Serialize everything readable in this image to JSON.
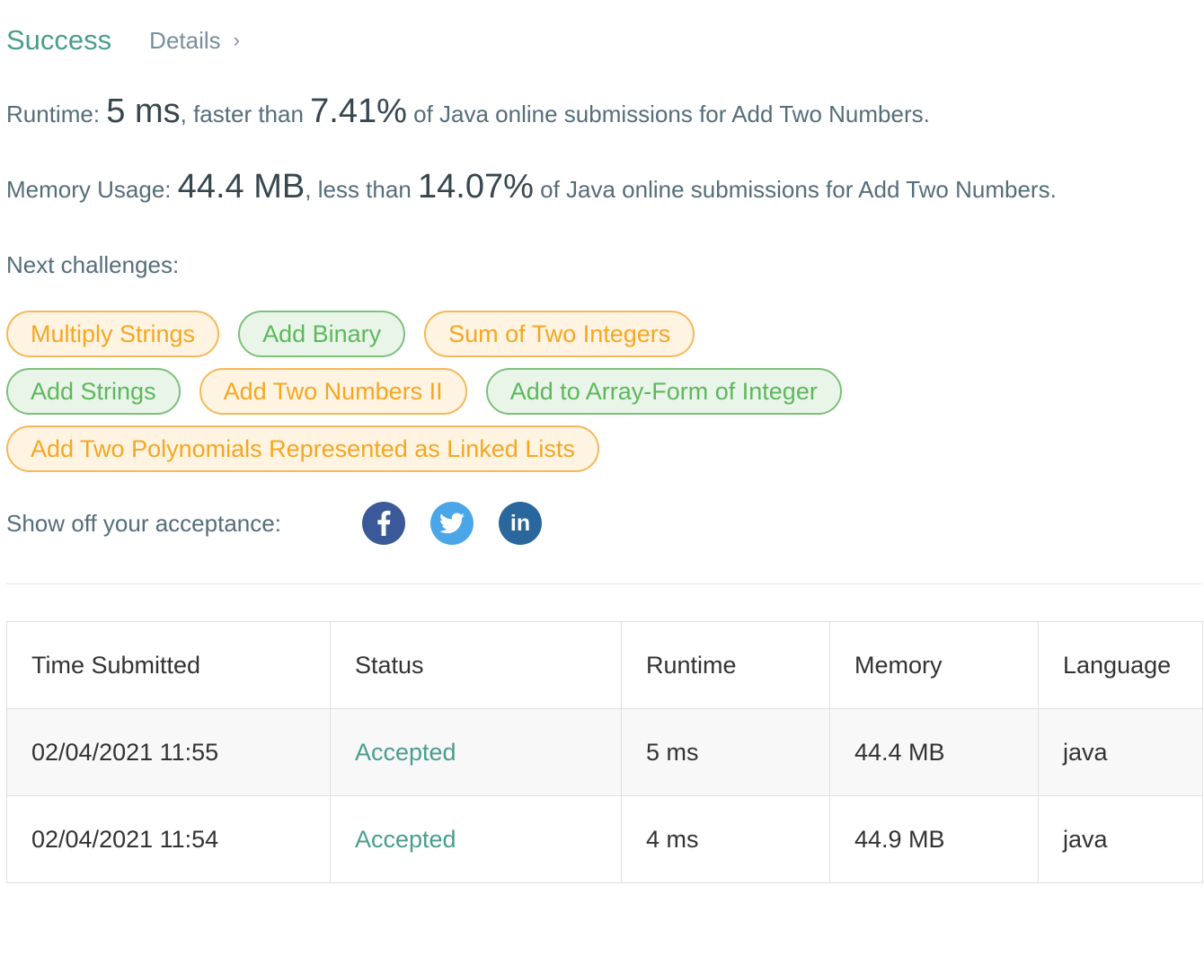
{
  "header": {
    "status": "Success",
    "details_label": "Details",
    "details_chevron": "›"
  },
  "runtime": {
    "label": "Runtime: ",
    "value": "5 ms",
    "comparison": ", faster than ",
    "percent": "7.41%",
    "suffix": " of Java online submissions for Add Two Numbers."
  },
  "memory": {
    "label": "Memory Usage: ",
    "value": "44.4 MB",
    "comparison": ", less than ",
    "percent": "14.07%",
    "suffix": " of Java online submissions for Add Two Numbers."
  },
  "next_challenges": {
    "label": "Next challenges:",
    "items": [
      {
        "label": "Multiply Strings",
        "color": "orange"
      },
      {
        "label": "Add Binary",
        "color": "green"
      },
      {
        "label": "Sum of Two Integers",
        "color": "orange"
      },
      {
        "label": "Add Strings",
        "color": "green"
      },
      {
        "label": "Add Two Numbers II",
        "color": "orange"
      },
      {
        "label": "Add to Array-Form of Integer",
        "color": "green"
      },
      {
        "label": "Add Two Polynomials Represented as Linked Lists",
        "color": "orange"
      }
    ]
  },
  "share": {
    "label": "Show off your acceptance:",
    "icons": [
      "facebook-icon",
      "twitter-icon",
      "linkedin-icon"
    ],
    "linkedin_text": "in"
  },
  "table": {
    "headers": [
      "Time Submitted",
      "Status",
      "Runtime",
      "Memory",
      "Language"
    ],
    "rows": [
      [
        "02/04/2021 11:55",
        "Accepted",
        "5 ms",
        "44.4 MB",
        "java"
      ],
      [
        "02/04/2021 11:54",
        "Accepted",
        "4 ms",
        "44.9 MB",
        "java"
      ]
    ]
  },
  "colors": {
    "success": "#4a9d8f",
    "orange_tag": "#f5a623",
    "green_tag": "#5cb85c",
    "facebook": "#3b5998",
    "twitter": "#4aa6e6",
    "linkedin": "#2a679c"
  }
}
